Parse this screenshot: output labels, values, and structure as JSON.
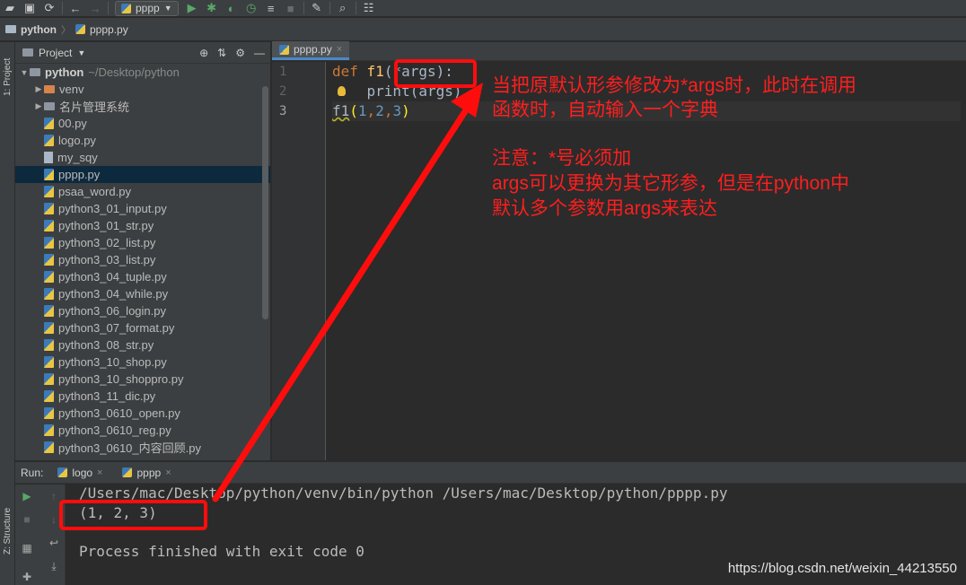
{
  "toolbar": {
    "run_config": "pppp"
  },
  "navbar": {
    "project": "python",
    "file": "pppp.py"
  },
  "left_strip": {
    "project_tab": "1: Project",
    "structure_tab": "Z: Structure"
  },
  "project_panel": {
    "title": "Project",
    "root": {
      "name": "python",
      "path": "~/Desktop/python"
    },
    "items": [
      {
        "name": "venv",
        "kind": "folder"
      },
      {
        "name": "名片管理系统",
        "kind": "folder"
      },
      {
        "name": "00.py",
        "kind": "py"
      },
      {
        "name": "logo.py",
        "kind": "py"
      },
      {
        "name": "my_sqy",
        "kind": "text"
      },
      {
        "name": "pppp.py",
        "kind": "py"
      },
      {
        "name": "psaa_word.py",
        "kind": "py"
      },
      {
        "name": "python3_01_input.py",
        "kind": "py"
      },
      {
        "name": "python3_01_str.py",
        "kind": "py"
      },
      {
        "name": "python3_02_list.py",
        "kind": "py"
      },
      {
        "name": "python3_03_list.py",
        "kind": "py"
      },
      {
        "name": "python3_04_tuple.py",
        "kind": "py"
      },
      {
        "name": "python3_04_while.py",
        "kind": "py"
      },
      {
        "name": "python3_06_login.py",
        "kind": "py"
      },
      {
        "name": "python3_07_format.py",
        "kind": "py"
      },
      {
        "name": "python3_08_str.py",
        "kind": "py"
      },
      {
        "name": "python3_10_shop.py",
        "kind": "py"
      },
      {
        "name": "python3_10_shoppro.py",
        "kind": "py"
      },
      {
        "name": "python3_11_dic.py",
        "kind": "py"
      },
      {
        "name": "python3_0610_open.py",
        "kind": "py"
      },
      {
        "name": "python3_0610_reg.py",
        "kind": "py"
      },
      {
        "name": "python3_0610_内容回顾.py",
        "kind": "py"
      }
    ]
  },
  "editor": {
    "tab": "pppp.py",
    "line_numbers": [
      "1",
      "2",
      "3"
    ],
    "code": {
      "l1_kw": "def",
      "l1_fn": "f1",
      "l1_rest": "(*args):",
      "l2": "    print(args)",
      "l3_fn": "f1",
      "l3_open": "(",
      "l3_n1": "1",
      "l3_c1": ",",
      "l3_n2": "2",
      "l3_c2": ",",
      "l3_n3": "3",
      "l3_close": ")"
    }
  },
  "annotation": {
    "line1": "当把原默认形参修改为*args时，此时在调用",
    "line2": "函数时，自动输入一个字典",
    "line3": "注意：*号必须加",
    "line4": "args可以更换为其它形参，但是在python中",
    "line5": "默认多个参数用args来表达"
  },
  "run_panel": {
    "label": "Run:",
    "tabs": [
      "logo",
      "pppp"
    ],
    "console": [
      "/Users/mac/Desktop/python/venv/bin/python /Users/mac/Desktop/python/pppp.py",
      "(1, 2, 3)",
      "Process finished with exit code 0"
    ]
  },
  "watermark": "https://blog.csdn.net/weixin_44213550",
  "colors": {
    "annotation_red": "#ff0d0d",
    "keyword": "#cc7832",
    "function": "#ffc66d",
    "number": "#6897bb",
    "selection": "#0d293e"
  }
}
